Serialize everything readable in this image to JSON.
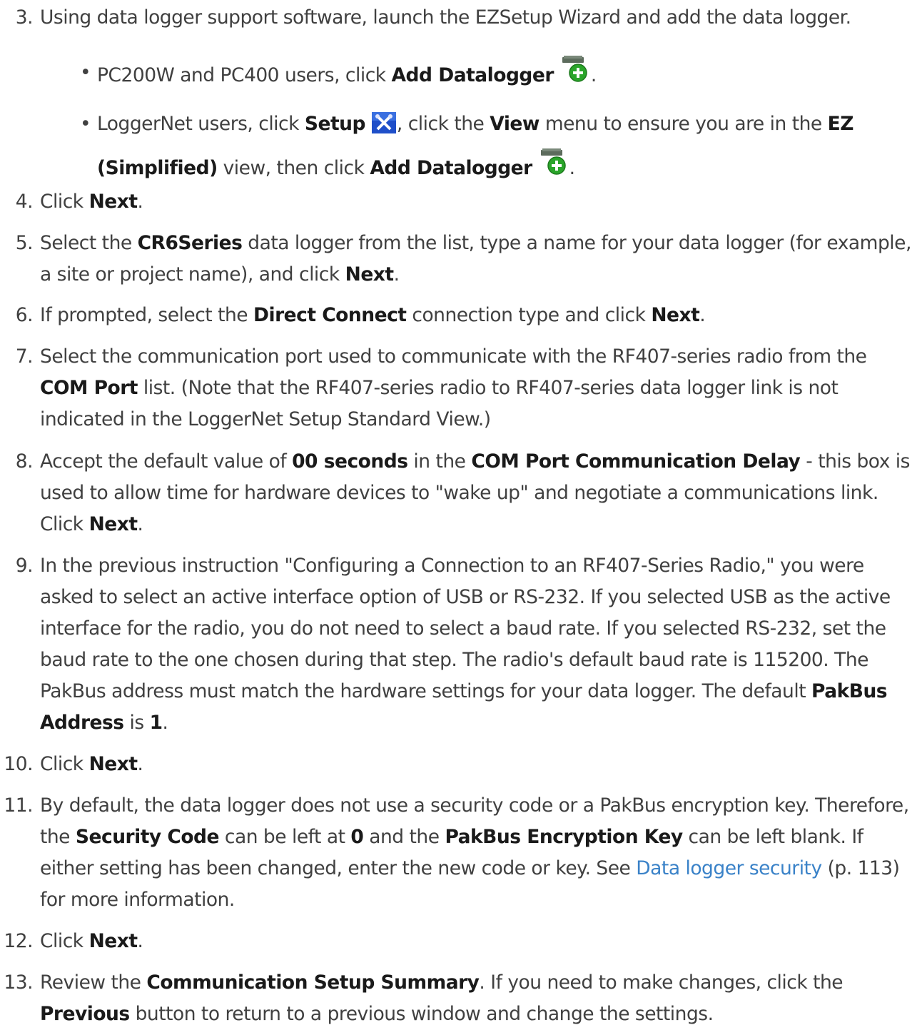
{
  "steps": [
    {
      "num": "3.",
      "parts": [
        {
          "t": "Using data logger support software, launch the EZSetup Wizard and add the data logger."
        }
      ]
    },
    {
      "num": "4.",
      "parts": [
        {
          "t": "Click "
        },
        {
          "t": "Next",
          "b": true
        },
        {
          "t": "."
        }
      ]
    },
    {
      "num": "5.",
      "parts": [
        {
          "t": "Select the "
        },
        {
          "t": "CR6Series",
          "b": true
        },
        {
          "t": " data logger from the list, type a name for your data logger (for example, a site or project name), and click "
        },
        {
          "t": "Next",
          "b": true
        },
        {
          "t": "."
        }
      ]
    },
    {
      "num": "6.",
      "parts": [
        {
          "t": "If prompted, select the "
        },
        {
          "t": "Direct Connect",
          "b": true
        },
        {
          "t": " connection type and click "
        },
        {
          "t": "Next",
          "b": true
        },
        {
          "t": "."
        }
      ]
    },
    {
      "num": "7.",
      "parts": [
        {
          "t": "Select the communication port used to communicate with the RF407-series radio from the "
        },
        {
          "t": "COM Port",
          "b": true
        },
        {
          "t": " list. (Note that the RF407-series radio to RF407-series data logger link is not indicated in the LoggerNet Setup Standard View.)"
        }
      ]
    },
    {
      "num": "8.",
      "parts": [
        {
          "t": "Accept the default value of "
        },
        {
          "t": "00 seconds",
          "b": true
        },
        {
          "t": " in the "
        },
        {
          "t": "COM Port Communication Delay",
          "b": true
        },
        {
          "t": " - this box is used to allow time for hardware devices to \"wake up\" and negotiate a communications link. Click "
        },
        {
          "t": "Next",
          "b": true
        },
        {
          "t": "."
        }
      ]
    },
    {
      "num": "9.",
      "parts": [
        {
          "t": "In the previous instruction \"Configuring a Connection to an RF407-Series Radio,\" you were asked to select an active interface option of USB or RS-232. If you selected USB as the active interface for the radio, you do not need to select a baud rate. If you selected RS-232, set the baud rate to the one chosen during that step. The radio's default baud rate is 115200. The PakBus address must match the hardware settings for your data logger. The default "
        },
        {
          "t": "PakBus Address",
          "b": true
        },
        {
          "t": " is "
        },
        {
          "t": "1",
          "b": true
        },
        {
          "t": "."
        }
      ]
    },
    {
      "num": "10.",
      "parts": [
        {
          "t": "Click "
        },
        {
          "t": "Next",
          "b": true
        },
        {
          "t": "."
        }
      ]
    },
    {
      "num": "11.",
      "parts": [
        {
          "t": "By default, the data logger does not use a security code or a PakBus encryption key. Therefore, the "
        },
        {
          "t": "Security Code",
          "b": true
        },
        {
          "t": " can be left at "
        },
        {
          "t": "0",
          "b": true
        },
        {
          "t": " and the "
        },
        {
          "t": "PakBus Encryption Key",
          "b": true
        },
        {
          "t": " can be left blank. If either setting has been changed, enter the new code or key. See "
        },
        {
          "t": "Data logger security",
          "link": true
        },
        {
          "t": " (p. 113) for more information."
        }
      ]
    },
    {
      "num": "12.",
      "parts": [
        {
          "t": "Click "
        },
        {
          "t": "Next",
          "b": true
        },
        {
          "t": "."
        }
      ]
    },
    {
      "num": "13.",
      "parts": [
        {
          "t": "Review the "
        },
        {
          "t": "Communication Setup Summary",
          "b": true
        },
        {
          "t": ". If you need to make changes, click the "
        },
        {
          "t": "Previous",
          "b": true
        },
        {
          "t": " button to return to a previous window and change the settings."
        }
      ]
    }
  ],
  "bullets": [
    {
      "parts": [
        {
          "t": "PC200W and PC400 users, click "
        },
        {
          "t": "Add Datalogger",
          "b": true
        },
        {
          "icon": "add-datalogger-icon"
        },
        {
          "t": "."
        }
      ]
    },
    {
      "parts": [
        {
          "t": "LoggerNet users, click "
        },
        {
          "t": "Setup",
          "b": true
        },
        {
          "icon": "setup-icon"
        },
        {
          "t": ", click the "
        },
        {
          "t": "View",
          "b": true
        },
        {
          "t": " menu to ensure you are in the "
        },
        {
          "t": "EZ (Simplified)",
          "b": true
        },
        {
          "t": " view, then click "
        },
        {
          "t": "Add Datalogger",
          "b": true
        },
        {
          "icon": "add-datalogger-icon"
        },
        {
          "t": "."
        }
      ]
    }
  ],
  "colors": {
    "text": "#404040",
    "bold": "#1a1a1a",
    "link": "#3a82c8",
    "add_icon_green": "#2aa52a",
    "setup_icon_blue": "#1f4fc9"
  }
}
